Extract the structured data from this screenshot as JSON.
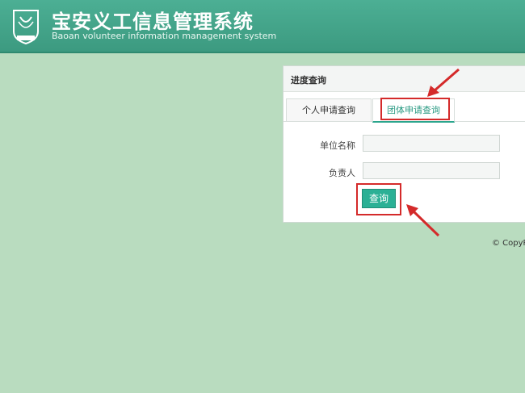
{
  "header": {
    "title_cn": "宝安义工信息管理系统",
    "title_en": "Baoan volunteer information management system",
    "logo_text": "宝安义工"
  },
  "panel": {
    "title": "进度查询",
    "tabs": [
      {
        "label": "个人申请查询",
        "active": false
      },
      {
        "label": "团体申请查询",
        "active": true
      }
    ],
    "fields": {
      "unit_name_label": "单位名称",
      "unit_name_value": "",
      "person_label": "负责人",
      "person_value": ""
    },
    "query_button": "查询"
  },
  "footer": {
    "copyright": "© CopyR"
  },
  "colors": {
    "header_bg": "#3c9a80",
    "page_bg": "#b9dcbf",
    "accent": "#2bb095",
    "annotation_red": "#d42a2a"
  }
}
